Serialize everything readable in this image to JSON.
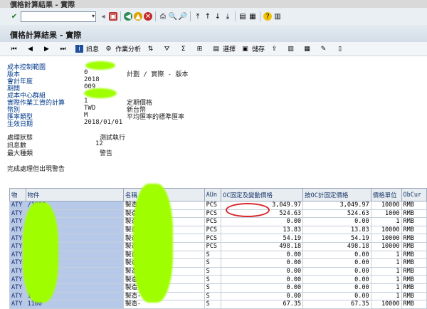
{
  "window": {
    "title": "價格計算結果 - 實際"
  },
  "toolbar1": {
    "command_field": "",
    "icons": [
      "enter-icon",
      "save-icon",
      "back-icon",
      "exit-icon",
      "cancel-icon",
      "print-icon",
      "find-icon",
      "find-next-icon",
      "first-page-icon",
      "prev-page-icon",
      "next-page-icon",
      "last-page-icon",
      "new-session-icon",
      "shortcut-icon",
      "help-icon",
      "layout-icon"
    ]
  },
  "header": {
    "title": "價格計算結果 - 實際"
  },
  "toolbar2": {
    "buttons": [
      {
        "label": "",
        "icon": "first-icon"
      },
      {
        "label": "",
        "icon": "prev-icon"
      },
      {
        "label": "",
        "icon": "next-icon"
      },
      {
        "label": "",
        "icon": "last-icon"
      },
      {
        "label": "訊息",
        "icon": "info-icon"
      },
      {
        "label": "作業分析",
        "icon": "analysis-icon"
      },
      {
        "label": "",
        "icon": "sort-icon"
      },
      {
        "label": "",
        "icon": "filter-icon"
      },
      {
        "label": "",
        "icon": "sum-icon"
      },
      {
        "label": "",
        "icon": "subtotal-icon"
      },
      {
        "label": "選擇",
        "icon": "select-icon"
      },
      {
        "label": "儲存",
        "icon": "save-layout-icon"
      }
    ]
  },
  "info": {
    "rows": [
      {
        "label": "成本控制範圍",
        "v1": "",
        "v2": ""
      },
      {
        "label": "版本",
        "v1": "0",
        "v2": "計劃 / 實際 - 版本"
      },
      {
        "label": "會計年度",
        "v1": "2018",
        "v2": ""
      },
      {
        "label": "期間",
        "v1": "009",
        "v2": ""
      },
      {
        "label": "成本中心群組",
        "v1": "",
        "v2": ""
      },
      {
        "label": "實際作業工資的計算",
        "v1": "1",
        "v2": "定期價格"
      },
      {
        "label": "幣別",
        "v1": "TWD",
        "v2": "新台幣"
      },
      {
        "label": "匯率類型",
        "v1": "M",
        "v2": "平均匯率的標準匯率"
      },
      {
        "label": "生效日期",
        "v1": "2018/01/01",
        "v2": ""
      }
    ],
    "status_rows": [
      {
        "label": "處理狀態",
        "value": "測試執行"
      },
      {
        "label": "訊息數",
        "value": "12"
      },
      {
        "label": "最大種類",
        "value": "警告"
      }
    ],
    "message": "完成處理但出現警告"
  },
  "table": {
    "columns": [
      "物",
      "物件",
      "名稱",
      "AUn",
      "OC固定及變動價格",
      "按OC計固定價格",
      "價格單位",
      "ObCur"
    ],
    "rows": [
      {
        "c0": "ATY",
        "c1": "/1000",
        "c2": "製造-",
        "c3": "PCS",
        "c4": "3,049.97",
        "c5": "3,049.97",
        "c6": "10000",
        "c7": "RMB"
      },
      {
        "c0": "ATY",
        "c1": "/1010",
        "c2": "製造-",
        "c3": "PCS",
        "c4": "524.63",
        "c5": "524.63",
        "c6": "1000",
        "c7": "RMB"
      },
      {
        "c0": "ATY",
        "c1": "/1011",
        "c2": "製造-",
        "c3": "PCS",
        "c4": "0.00",
        "c5": "0.00",
        "c6": "1",
        "c7": "RMB"
      },
      {
        "c0": "ATY",
        "c1": "/1012",
        "c2": "製造-",
        "c3": "PCS",
        "c4": "13.83",
        "c5": "13.83",
        "c6": "10000",
        "c7": "RMB"
      },
      {
        "c0": "ATY",
        "c1": "/1013",
        "c2": "製造-",
        "c3": "PCS",
        "c4": "54.19",
        "c5": "54.19",
        "c6": "10000",
        "c7": "RMB"
      },
      {
        "c0": "ATY",
        "c1": "/1014",
        "c2": "製造-",
        "c3": "PCS",
        "c4": "498.18",
        "c5": "498.18",
        "c6": "10000",
        "c7": "RMB"
      },
      {
        "c0": "ATY",
        "c1": "1100",
        "c2": "製造-",
        "c3": "S",
        "c4": "0.00",
        "c5": "0.00",
        "c6": "1",
        "c7": "RMB"
      },
      {
        "c0": "ATY",
        "c1": "1110",
        "c2": "製造-",
        "c3": "S",
        "c4": "0.00",
        "c5": "0.00",
        "c6": "1",
        "c7": "RMB"
      },
      {
        "c0": "ATY",
        "c1": "1111",
        "c2": "製造-",
        "c3": "S",
        "c4": "0.00",
        "c5": "0.00",
        "c6": "1",
        "c7": "RMB"
      },
      {
        "c0": "ATY",
        "c1": "1112",
        "c2": "製造-",
        "c3": "S",
        "c4": "0.00",
        "c5": "0.00",
        "c6": "1",
        "c7": "RMB"
      },
      {
        "c0": "ATY",
        "c1": "1113",
        "c2": "製造-",
        "c3": "S",
        "c4": "0.00",
        "c5": "0.00",
        "c6": "1",
        "c7": "RMB"
      },
      {
        "c0": "ATY",
        "c1": "1114",
        "c2": "製造-",
        "c3": "S",
        "c4": "0.00",
        "c5": "0.00",
        "c6": "1",
        "c7": "RMB"
      },
      {
        "c0": "ATY",
        "c1": "1100",
        "c2": "製造-",
        "c3": "S",
        "c4": "67.35",
        "c5": "67.35",
        "c6": "10000",
        "c7": "RMB"
      }
    ]
  },
  "colors": {
    "highlight": "#d8262b",
    "key_cell": "#b7c9e8",
    "redaction": "#9fff00"
  }
}
